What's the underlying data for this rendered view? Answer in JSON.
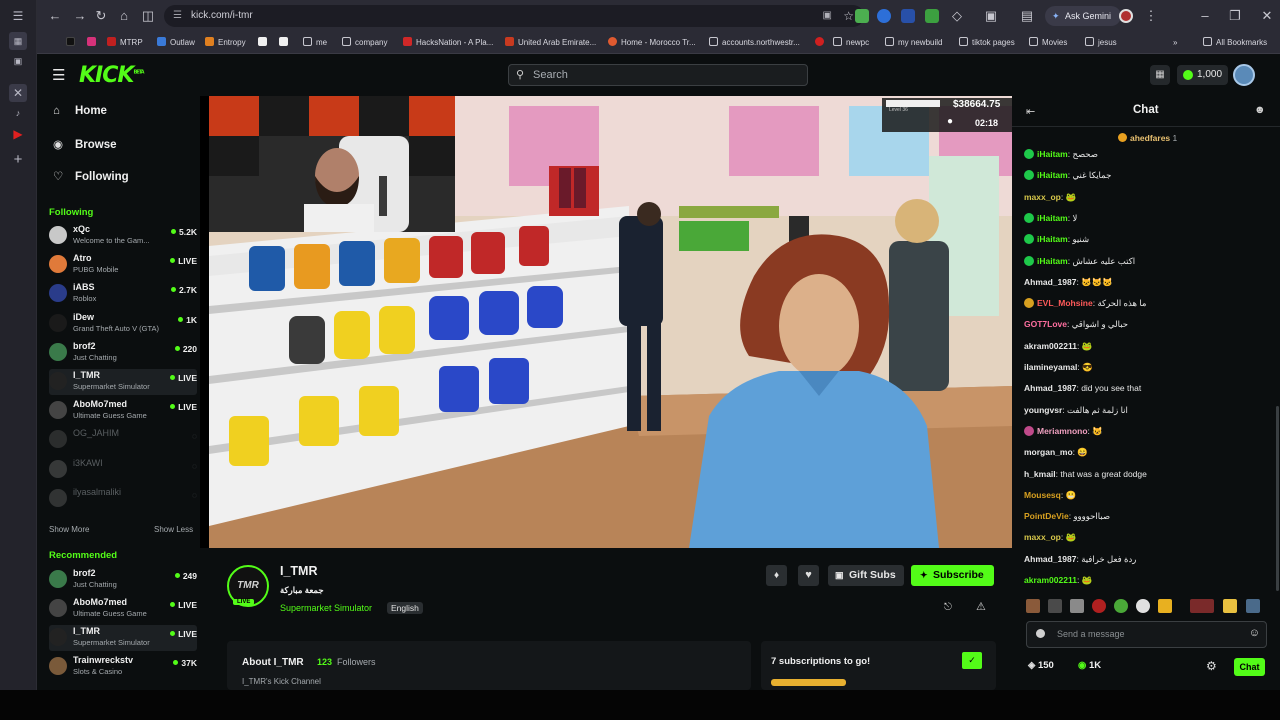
{
  "browser": {
    "url": "kick.com/i-tmr",
    "ask_gemini": "Ask Gemini",
    "all_bookmarks": "All Bookmarks",
    "bookmarks": [
      "MTRP",
      "Outlaw",
      "Entropy",
      "me",
      "company",
      "HacksNation - A Pla...",
      "United Arab Emirate...",
      "Home - Morocco Tr...",
      "accounts.northwestr...",
      "newpc",
      "my newbuild",
      "tiktok pages",
      "Movies",
      "jesus"
    ]
  },
  "header": {
    "logo": "KICK",
    "logo_sup": "BETA",
    "search_placeholder": "Search",
    "coins": "1,000"
  },
  "sidebar": {
    "nav": [
      {
        "label": "Home",
        "icon": "home-icon"
      },
      {
        "label": "Browse",
        "icon": "compass-icon"
      },
      {
        "label": "Following",
        "icon": "heart-icon"
      }
    ],
    "following_title": "Following",
    "following": [
      {
        "name": "xQc",
        "game": "Welcome to the Gam...",
        "viewers": "5.2K",
        "color": "#c8c8c8"
      },
      {
        "name": "Atro",
        "game": "PUBG Mobile",
        "viewers": "LIVE",
        "color": "#e07a3a"
      },
      {
        "name": "iABS",
        "game": "Roblox",
        "viewers": "2.7K",
        "color": "#2a3c8a"
      },
      {
        "name": "iDew",
        "game": "Grand Theft Auto V (GTA)",
        "viewers": "1K",
        "color": "#1a1a1a"
      },
      {
        "name": "brof2",
        "game": "Just Chatting",
        "viewers": "220",
        "color": "#3a7a4a"
      },
      {
        "name": "I_TMR",
        "game": "Supermarket Simulator",
        "viewers": "LIVE",
        "color": "#222222"
      },
      {
        "name": "AboMo7med",
        "game": "Ultimate Guess Game",
        "viewers": "LIVE",
        "color": "#444444"
      },
      {
        "name": "OG_JAHIM",
        "game": "",
        "viewers": "",
        "color": "#666666"
      },
      {
        "name": "i3KAWI",
        "game": "",
        "viewers": "",
        "color": "#888888"
      },
      {
        "name": "ilyasalmaliki",
        "game": "",
        "viewers": "",
        "color": "#777777"
      }
    ],
    "show_more": "Show More",
    "show_less": "Show Less",
    "recommended_title": "Recommended",
    "recommended": [
      {
        "name": "brof2",
        "game": "Just Chatting",
        "viewers": "249",
        "color": "#3a7a4a"
      },
      {
        "name": "AboMo7med",
        "game": "Ultimate Guess Game",
        "viewers": "LIVE",
        "color": "#444444"
      },
      {
        "name": "I_TMR",
        "game": "Supermarket Simulator",
        "viewers": "LIVE",
        "color": "#222222"
      },
      {
        "name": "Trainwreckstv",
        "game": "Slots & Casino",
        "viewers": "37K",
        "color": "#7a5a3a"
      }
    ]
  },
  "video": {
    "hud_money": "$38664.75",
    "hud_time": "02:18",
    "hud_level": "Level 36"
  },
  "stream": {
    "channel": "I_TMR",
    "title": "جمعة مباركة",
    "category": "Supermarket Simulator",
    "language": "English",
    "live_badge": "LIVE",
    "gift_subs": "Gift Subs",
    "subscribe": "Subscribe",
    "about_label": "About I_TMR",
    "followers_count": "123",
    "followers_label": "Followers",
    "channel_tagline": "I_TMR's Kick Channel",
    "subs_goal": "7 subscriptions to go!"
  },
  "chat": {
    "title": "Chat",
    "pinned_user": "ahedfares",
    "pinned_count": "1",
    "messages": [
      {
        "user": "iHaitam",
        "text": "صحصح",
        "color": "#53fc18",
        "badge": "#1ec94a"
      },
      {
        "user": "iHaitam",
        "text": "جمايكا غني",
        "color": "#53fc18",
        "badge": "#1ec94a"
      },
      {
        "user": "maxx_op",
        "text": "🐸",
        "color": "#d6c64a",
        "badge": ""
      },
      {
        "user": "iHaitam",
        "text": "لا",
        "color": "#53fc18",
        "badge": "#1ec94a"
      },
      {
        "user": "iHaitam",
        "text": "شنيو",
        "color": "#53fc18",
        "badge": "#1ec94a"
      },
      {
        "user": "iHaitam",
        "text": "اكتب عليه عشاش",
        "color": "#53fc18",
        "badge": "#1ec94a"
      },
      {
        "user": "Ahmad_1987",
        "text": "🐱🐱🐱",
        "color": "#e8e8e8",
        "badge": ""
      },
      {
        "user": "EVL_Mohsine",
        "text": "ما هذه الحركة",
        "color": "#ff5a5a",
        "badge": "#d8a020"
      },
      {
        "user": "GOT7Love",
        "text": "حبالي و اشواقي",
        "color": "#ff6fa0",
        "badge": ""
      },
      {
        "user": "akram002211",
        "text": "🐸",
        "color": "#e8e8e8",
        "badge": ""
      },
      {
        "user": "ilamineyamal",
        "text": "😎",
        "color": "#e8e8e8",
        "badge": ""
      },
      {
        "user": "Ahmad_1987",
        "text": "did you see that",
        "color": "#e8e8e8",
        "badge": ""
      },
      {
        "user": "youngvsr",
        "text": "انا زلمة ثم هالفت",
        "color": "#e8e8e8",
        "badge": ""
      },
      {
        "user": "Meriamnono",
        "text": "😺",
        "color": "#f0a0c0",
        "badge": "#c04a8a"
      },
      {
        "user": "morgan_mo",
        "text": "😄",
        "color": "#e8e8e8",
        "badge": ""
      },
      {
        "user": "h_kmail",
        "text": "that was a great dodge",
        "color": "#e8e8e8",
        "badge": ""
      },
      {
        "user": "Mousesq",
        "text": "😬",
        "color": "#d8a020",
        "badge": ""
      },
      {
        "user": "PointDeVie",
        "text": "صبااحوووو",
        "color": "#d8a020",
        "badge": ""
      },
      {
        "user": "maxx_op",
        "text": "🐸",
        "color": "#d6c64a",
        "badge": ""
      },
      {
        "user": "Ahmad_1987",
        "text": "ردة فعل خرافية",
        "color": "#e8e8e8",
        "badge": ""
      },
      {
        "user": "akram002211",
        "text": "🐸",
        "color": "#53fc18",
        "badge": ""
      }
    ],
    "send_placeholder": "Send a message",
    "points": "150",
    "kicks": "1K",
    "send_button": "Chat"
  }
}
